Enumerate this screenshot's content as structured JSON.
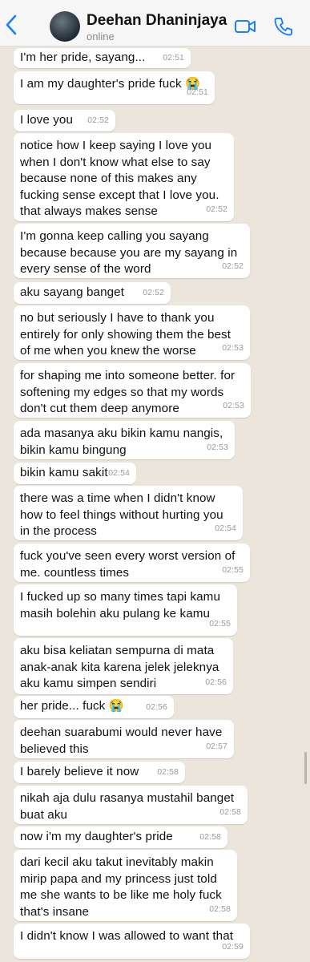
{
  "header": {
    "contact_name": "Deehan Dhaninjaya",
    "status": "online",
    "back_icon": "chevron-left-icon",
    "video_icon": "video-call-icon",
    "phone_icon": "phone-icon",
    "accent_color": "#1a80f3"
  },
  "messages": [
    {
      "text": "I'm her pride, sayang...",
      "time": "02:51"
    },
    {
      "text": "I am my daughter's pride fuck 😭",
      "time": "02:51"
    },
    {
      "text": "I love you",
      "time": "02:52"
    },
    {
      "text": "notice how I keep saying I love you\nwhen I don't know what else to say\nbecause none of this makes any\nfucking sense except that I love you.\nthat always makes sense",
      "time": "02:52"
    },
    {
      "text": "I'm gonna keep calling you sayang\nbecause because you are my sayang in\nevery sense of the word",
      "time": "02:52"
    },
    {
      "text": "aku sayang banget",
      "time": "02:52"
    },
    {
      "text": "no but seriously I have to thank you\nentirely for only showing them the best\nof me when you knew the worse",
      "time": "02:53"
    },
    {
      "text": "for shaping me into someone better. for\nsoftening my edges so that my words\ndon't cut them deep anymore",
      "time": "02:53"
    },
    {
      "text": "ada masanya aku bikin kamu nangis,\nbikin kamu bingung",
      "time": "02:53"
    },
    {
      "text": "bikin kamu sakit",
      "time": "02:54"
    },
    {
      "text": "there was a time when I didn't know\nhow to feel things without hurting you\nin the process",
      "time": "02:54"
    },
    {
      "text": "fuck you've seen every worst version of\nme. countless times",
      "time": "02:55"
    },
    {
      "text": "I fucked up so many times tapi kamu\nmasih bolehin aku pulang ke kamu",
      "time": "02:55"
    },
    {
      "text": "aku bisa keliatan sempurna di mata\nanak-anak kita karena jelek jeleknya\naku kamu simpen sendiri",
      "time": "02:56"
    },
    {
      "text": "her pride... fuck 😭",
      "time": "02:56"
    },
    {
      "text": "deehan suarabumi would never have\nbelieved this",
      "time": "02:57"
    },
    {
      "text": "I barely believe it now",
      "time": "02:58"
    },
    {
      "text": "nikah aja dulu rasanya mustahil banget\nbuat aku",
      "time": "02:58"
    },
    {
      "text": "now i'm my daughter's pride",
      "time": "02:58"
    },
    {
      "text": "dari kecil aku takut inevitably makin\nmirip papa and my princess just told\nme she wants to be like me holy fuck\nthat's insane",
      "time": "02:58"
    },
    {
      "text": "I didn't know I was allowed to want that",
      "time": "02:59"
    }
  ]
}
